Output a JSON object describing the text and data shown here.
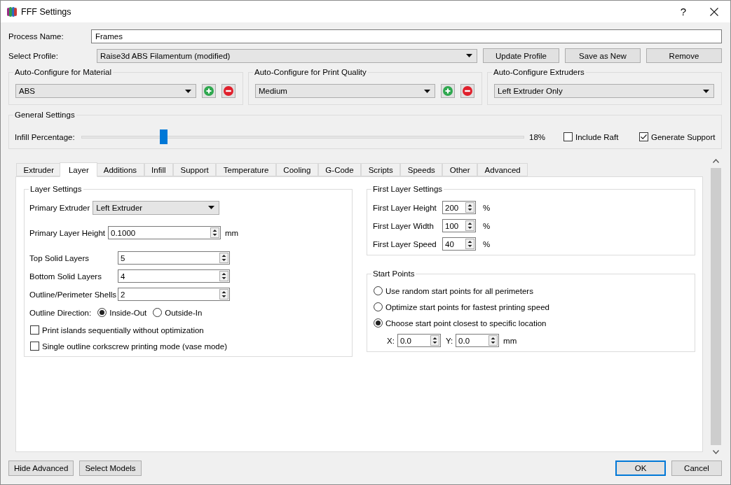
{
  "window": {
    "title": "FFF Settings",
    "help": "?"
  },
  "process_name": {
    "label": "Process Name:",
    "value": "Frames"
  },
  "profile": {
    "label": "Select Profile:",
    "value": "Raise3d ABS Filamentum (modified)",
    "buttons": [
      "Update Profile",
      "Save as New",
      "Remove"
    ]
  },
  "auto_configure": [
    {
      "title": "Auto-Configure for Material",
      "value": "ABS",
      "kind": "editable"
    },
    {
      "title": "Auto-Configure for Print Quality",
      "value": "Medium",
      "kind": "editable"
    },
    {
      "title": "Auto-Configure Extruders",
      "value": "Left Extruder Only",
      "kind": "fixed"
    }
  ],
  "general_settings": {
    "title": "General Settings",
    "infill": {
      "label": "Infill Percentage:",
      "level": 0.18,
      "reading": "18%"
    },
    "options": [
      {
        "label": "Include Raft",
        "checked": false
      },
      {
        "label": "Generate Support",
        "checked": true
      }
    ]
  },
  "tabs": [
    {
      "label": "Extruder",
      "selected": false
    },
    {
      "label": "Layer",
      "selected": true
    },
    {
      "label": "Additions",
      "selected": false
    },
    {
      "label": "Infill",
      "selected": false
    },
    {
      "label": "Support",
      "selected": false
    },
    {
      "label": "Temperature",
      "selected": false
    },
    {
      "label": "Cooling",
      "selected": false
    },
    {
      "label": "G-Code",
      "selected": false
    },
    {
      "label": "Scripts",
      "selected": false
    },
    {
      "label": "Speeds",
      "selected": false
    },
    {
      "label": "Other",
      "selected": false
    },
    {
      "label": "Advanced",
      "selected": false
    }
  ],
  "layer_settings": {
    "title": "Layer Settings",
    "primary_extruder": {
      "label": "Primary Extruder",
      "value": "Left Extruder"
    },
    "primary_layer_height": {
      "label": "Primary Layer Height",
      "value": "0.1000",
      "unit": "mm"
    },
    "layer_counts": [
      {
        "label": "Top Solid Layers",
        "value": "5"
      },
      {
        "label": "Bottom Solid Layers",
        "value": "4"
      },
      {
        "label": "Outline/Perimeter Shells",
        "value": "2"
      }
    ],
    "outline_direction": {
      "label": "Outline Direction:",
      "options": [
        {
          "label": "Inside-Out",
          "selected": true
        },
        {
          "label": "Outside-In",
          "selected": false
        }
      ]
    },
    "checkboxes": [
      {
        "label": "Print islands sequentially without optimization",
        "checked": false
      },
      {
        "label": "Single outline corkscrew printing mode (vase mode)",
        "checked": false
      }
    ]
  },
  "first_layer_settings": {
    "title": "First Layer Settings",
    "rows": [
      {
        "label": "First Layer Height",
        "value": "200",
        "unit": "%"
      },
      {
        "label": "First Layer Width",
        "value": "100",
        "unit": "%"
      },
      {
        "label": "First Layer Speed",
        "value": "40",
        "unit": "%"
      }
    ]
  },
  "start_points": {
    "title": "Start Points",
    "options": [
      {
        "label": "Use random start points for all perimeters",
        "selected": false
      },
      {
        "label": "Optimize start points for fastest printing speed",
        "selected": false
      },
      {
        "label": "Choose start point closest to specific location",
        "selected": true
      }
    ],
    "location": {
      "x_label": "X:",
      "x_value": "0.0",
      "y_label": "Y:",
      "y_value": "0.0",
      "unit": "mm"
    }
  },
  "footer": {
    "left_buttons": [
      "Hide Advanced",
      "Select Models"
    ],
    "right_buttons": [
      {
        "label": "OK",
        "default": true
      },
      {
        "label": "Cancel",
        "default": false
      }
    ]
  }
}
